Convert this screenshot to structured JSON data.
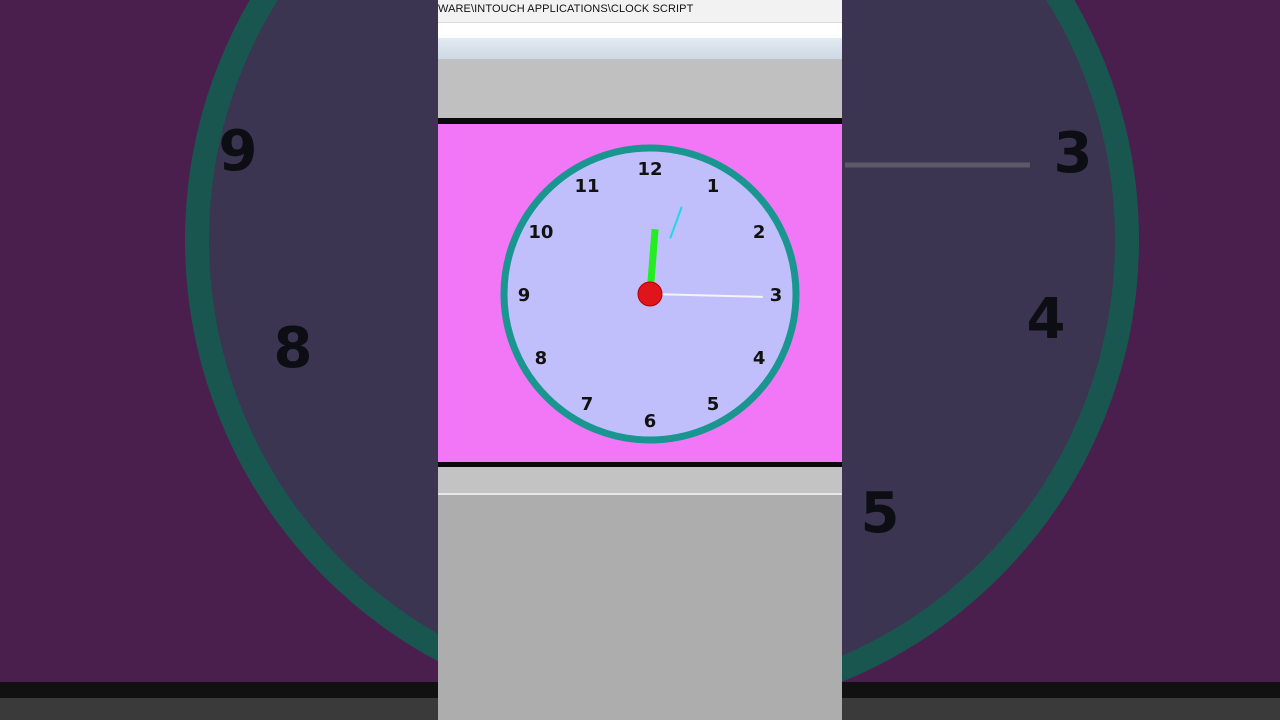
{
  "window": {
    "title": "WARE\\INTOUCH APPLICATIONS\\CLOCK SCRIPT"
  },
  "clock": {
    "numerals": [
      "12",
      "1",
      "2",
      "3",
      "4",
      "5",
      "6",
      "7",
      "8",
      "9",
      "10",
      "11"
    ],
    "time": {
      "hour": 12,
      "minute": 15,
      "second": 2
    },
    "colors": {
      "panel": "#f277f6",
      "face": "#c0bffc",
      "rim": "#1a9690",
      "hour_hand": "#22ee22",
      "minute_hand": "#f4f4f4",
      "second_hand": "#22d6e8",
      "center": "#e0141b"
    }
  },
  "background": {
    "visible_numerals": [
      "9",
      "8",
      "3",
      "4",
      "5"
    ]
  }
}
